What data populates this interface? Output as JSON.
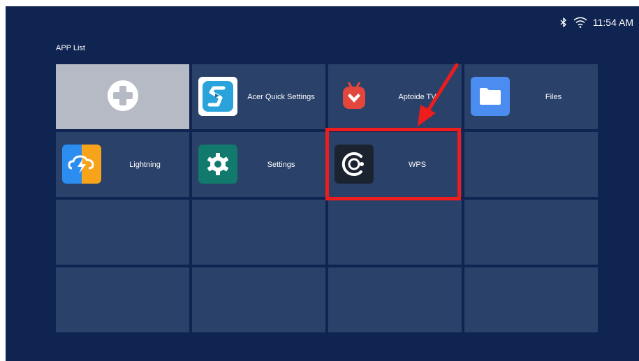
{
  "status_bar": {
    "bluetooth_icon": "bluetooth-icon",
    "wifi_icon": "wifi-icon",
    "time": "11:54 AM"
  },
  "page": {
    "title": "APP List"
  },
  "apps": [
    {
      "label": "",
      "icon": "add-icon"
    },
    {
      "label": "Acer Quick Settings",
      "icon": "acer-quick-settings-icon"
    },
    {
      "label": "Aptoide TV",
      "icon": "aptoide-tv-icon"
    },
    {
      "label": "Files",
      "icon": "folder-icon"
    },
    {
      "label": "Lightning",
      "icon": "lightning-icon"
    },
    {
      "label": "Settings",
      "icon": "gear-icon"
    },
    {
      "label": "WPS",
      "icon": "wps-icon"
    }
  ],
  "colors": {
    "background": "#0f2451",
    "tile": "#2a4169",
    "add_tile": "#b6bac4",
    "annotation": "#ee1c1c"
  }
}
